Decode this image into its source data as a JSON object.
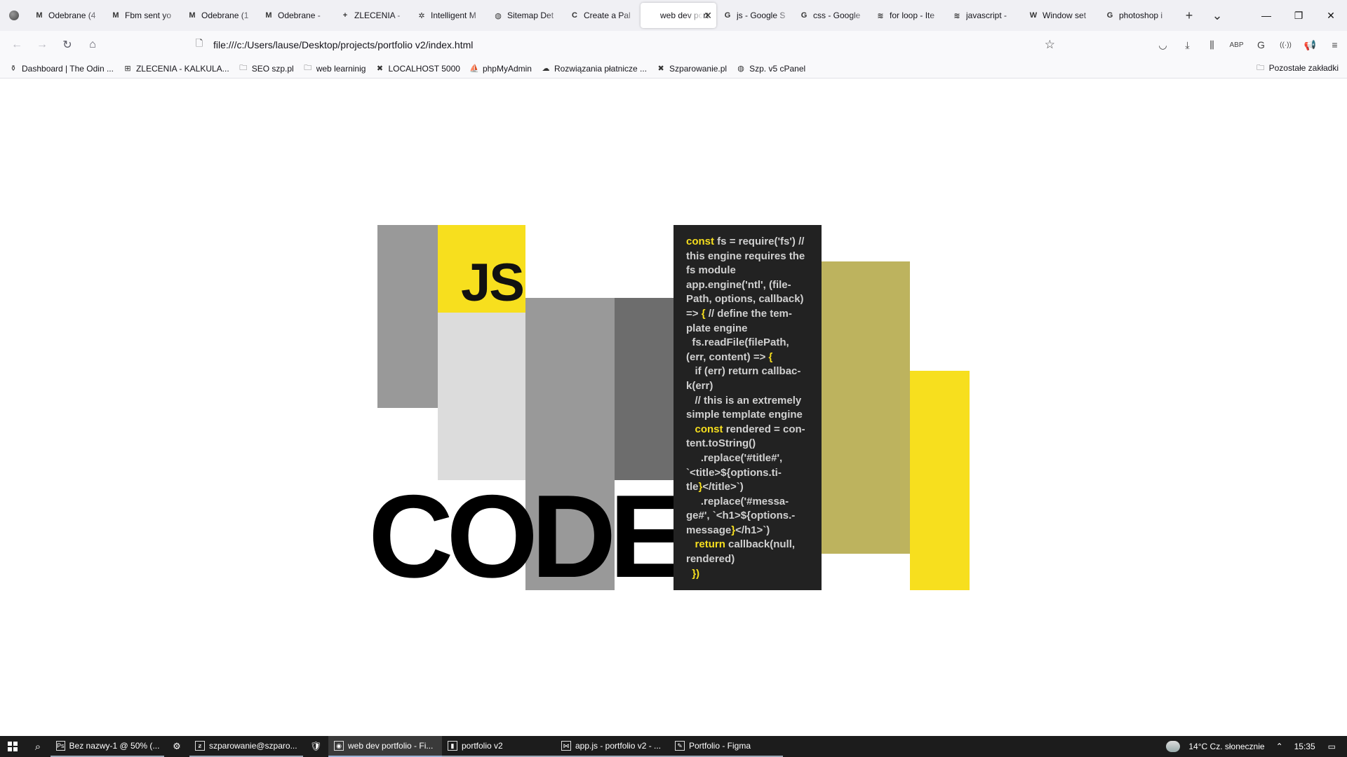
{
  "browser": {
    "tabs": [
      {
        "title": "Odebrane (4",
        "icon": "M",
        "active": false
      },
      {
        "title": "Fbm sent yo",
        "icon": "M",
        "active": false
      },
      {
        "title": "Odebrane (1",
        "icon": "M",
        "active": false
      },
      {
        "title": "Odebrane -",
        "icon": "M",
        "active": false
      },
      {
        "title": "ZLECENIA -",
        "icon": "+",
        "active": false
      },
      {
        "title": "Intelligent M",
        "icon": "✲",
        "active": false
      },
      {
        "title": "Sitemap Det",
        "icon": "◍",
        "active": false
      },
      {
        "title": "Create a Pal",
        "icon": "C",
        "active": false
      },
      {
        "title": "web dev port",
        "icon": "",
        "active": true
      },
      {
        "title": "js - Google S",
        "icon": "G",
        "active": false
      },
      {
        "title": "css - Google",
        "icon": "G",
        "active": false
      },
      {
        "title": "for loop - Ite",
        "icon": "≋",
        "active": false
      },
      {
        "title": "javascript -",
        "icon": "≋",
        "active": false
      },
      {
        "title": "Window set",
        "icon": "W",
        "active": false
      },
      {
        "title": "photoshop i",
        "icon": "G",
        "active": false
      }
    ],
    "tab_close_glyph": "✕",
    "new_tab_glyph": "+",
    "list_tabs_glyph": "⌄",
    "window_controls": {
      "minimize": "—",
      "restore": "❐",
      "close": "✕"
    },
    "url": "file:///c:/Users/lause/Desktop/projects/portfolio v2/index.html",
    "nav_glyphs": {
      "back": "←",
      "forward": "→",
      "reload": "↻",
      "home": "⌂",
      "page": "🗋",
      "star": "☆"
    },
    "toolbar_icons": [
      {
        "name": "pocket-icon",
        "glyph": "◡"
      },
      {
        "name": "downloads-icon",
        "glyph": "⤓"
      },
      {
        "name": "library-icon",
        "glyph": "⫼"
      },
      {
        "name": "adblock-icon",
        "glyph": "ABP"
      },
      {
        "name": "grammarly-icon",
        "glyph": "G"
      },
      {
        "name": "broadcast-icon",
        "glyph": "((·))"
      },
      {
        "name": "megaphone-icon",
        "glyph": "📢"
      },
      {
        "name": "menu-icon",
        "glyph": "≡"
      }
    ],
    "bookmarks": [
      {
        "label": "Dashboard | The Odin ...",
        "icon": "⚱"
      },
      {
        "label": "ZLECENIA - KALKULA...",
        "icon": "⊞"
      },
      {
        "label": "SEO szp.pl",
        "icon": "🗀"
      },
      {
        "label": "web learninig",
        "icon": "🗀"
      },
      {
        "label": "LOCALHOST 5000",
        "icon": "✖"
      },
      {
        "label": "phpMyAdmin",
        "icon": "⛵"
      },
      {
        "label": "Rozwiązania płatnicze ...",
        "icon": "☁"
      },
      {
        "label": "Szparowanie.pl",
        "icon": "✖"
      },
      {
        "label": "Szp. v5 cPanel",
        "icon": "◍"
      }
    ],
    "other_bookmarks": {
      "label": "Pozostałe zakładki",
      "icon": "🗀"
    }
  },
  "page": {
    "js_label": "JS",
    "code_word": "CODE",
    "colors": {
      "js_yellow": "#f7df1e",
      "olive": "#bdb35e",
      "gray_dark": "#6d6d6d",
      "gray_mid": "#999999",
      "gray_light": "#dcdcdc",
      "panel_bg": "#222222"
    },
    "code_lines": [
      [
        [
          "kw",
          "const"
        ],
        [
          "t",
          " fs = require('fs') //"
        ]
      ],
      [
        [
          "t",
          "this engine requires the"
        ]
      ],
      [
        [
          "t",
          "fs module"
        ]
      ],
      [
        [
          "t",
          "app.engine('ntl', (file-"
        ]
      ],
      [
        [
          "t",
          "Path, options, callback)"
        ]
      ],
      [
        [
          "t",
          "=> "
        ],
        [
          "kw",
          "{"
        ],
        [
          "t",
          " // define the tem-"
        ]
      ],
      [
        [
          "t",
          "plate engine"
        ]
      ],
      [
        [
          "t",
          "  fs.readFile(filePath,"
        ]
      ],
      [
        [
          "t",
          "(err, content) => "
        ],
        [
          "kw",
          "{"
        ]
      ],
      [
        [
          "t",
          "   if (err) return callbac-"
        ]
      ],
      [
        [
          "t",
          "k(err)"
        ]
      ],
      [
        [
          "t",
          "   // this is an extremely"
        ]
      ],
      [
        [
          "t",
          "simple template engine"
        ]
      ],
      [
        [
          "t",
          "   "
        ],
        [
          "kw",
          "const"
        ],
        [
          "t",
          " rendered = con-"
        ]
      ],
      [
        [
          "t",
          "tent.toString()"
        ]
      ],
      [
        [
          "t",
          "     .replace('#title#',"
        ]
      ],
      [
        [
          "t",
          "`<title>${options.ti-"
        ]
      ],
      [
        [
          "t",
          "tle"
        ],
        [
          "kw",
          "}"
        ],
        [
          "t",
          "</title>`)"
        ]
      ],
      [
        [
          "t",
          "     .replace('#messa-"
        ]
      ],
      [
        [
          "t",
          "ge#', `<h1>${options.-"
        ]
      ],
      [
        [
          "t",
          "message"
        ],
        [
          "kw",
          "}"
        ],
        [
          "t",
          "</h1>`)"
        ]
      ],
      [
        [
          "t",
          "   "
        ],
        [
          "kw",
          "return"
        ],
        [
          "t",
          " callback(null,"
        ]
      ],
      [
        [
          "t",
          "rendered)"
        ]
      ],
      [
        [
          "t",
          "  "
        ],
        [
          "kw",
          "})"
        ]
      ]
    ]
  },
  "taskbar": {
    "apps": [
      {
        "label": "Bez nazwy-1 @ 50% (...",
        "icon": "Ps",
        "state": "running"
      },
      {
        "label": "",
        "icon": "⚙",
        "state": "icon"
      },
      {
        "label": "szparowanie@szparo...",
        "icon": "ƶ",
        "state": "running"
      },
      {
        "label": "",
        "icon": "🛡",
        "state": "icon"
      },
      {
        "label": "web dev portfolio - Fi...",
        "icon": "◉",
        "state": "active"
      },
      {
        "label": "portfolio v2",
        "icon": "▮",
        "state": "running"
      },
      {
        "label": "app.js - portfolio v2 - ...",
        "icon": "⋈",
        "state": "running"
      },
      {
        "label": "Portfolio - Figma",
        "icon": "✎",
        "state": "running"
      }
    ],
    "search_glyph": "⌕",
    "weather": "14°C  Cz. słonecznie",
    "chevron": "⌃",
    "time": "15:35",
    "notification_glyph": "▭"
  }
}
